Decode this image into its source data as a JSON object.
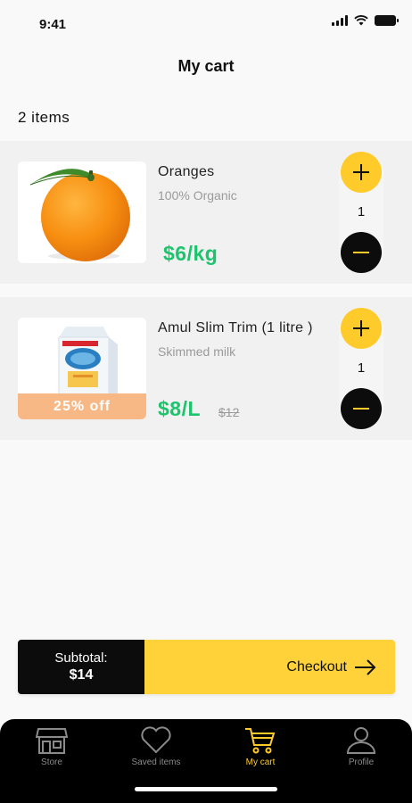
{
  "status_bar": {
    "time": "9:41"
  },
  "header": {
    "title": "My cart"
  },
  "cart": {
    "count_label": "2 items",
    "items": [
      {
        "name": "Oranges",
        "subtitle": "100% Organic",
        "price": "$6/kg",
        "quantity": "1",
        "image_icon": "orange-image"
      },
      {
        "name": "Amul Slim Trim (1 litre )",
        "subtitle": "Skimmed milk",
        "price": "$8/L",
        "old_price": "$12",
        "discount_badge": "25% off",
        "quantity": "1",
        "image_icon": "milk-carton-image"
      }
    ]
  },
  "checkout": {
    "subtotal_label": "Subtotal:",
    "subtotal_value": "$14",
    "button_label": "Checkout",
    "button_icon": "arrow-right-icon"
  },
  "nav": {
    "items": [
      {
        "label": "Store",
        "icon": "store-icon"
      },
      {
        "label": "Saved items",
        "icon": "heart-icon"
      },
      {
        "label": "My cart",
        "icon": "cart-icon",
        "active": true
      },
      {
        "label": "Profile",
        "icon": "user-icon"
      }
    ]
  },
  "colors": {
    "accent": "#ffcb2b",
    "price": "#1ec46d",
    "dark": "#0c0c0c",
    "badge": "#f7b886"
  }
}
